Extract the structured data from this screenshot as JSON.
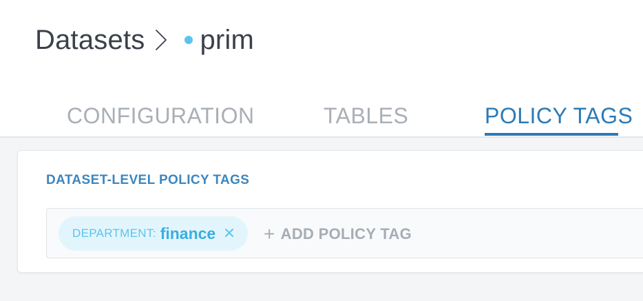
{
  "breadcrumb": {
    "parent": "Datasets",
    "separator_icon": "chevron-right-icon",
    "status_color": "#5bc4ee",
    "current": "prim"
  },
  "tabs": [
    {
      "label": "CONFIGURATION",
      "active": false
    },
    {
      "label": "TABLES",
      "active": false
    },
    {
      "label": "POLICY TAGS",
      "active": true
    }
  ],
  "policy_section": {
    "title": "DATASET-LEVEL POLICY TAGS",
    "tags": [
      {
        "key": "DEPARTMENT:",
        "value": "finance",
        "remove_icon": "close-icon"
      }
    ],
    "add_label": "ADD POLICY TAG",
    "add_icon": "plus-icon"
  },
  "colors": {
    "accent": "#2b7ab7",
    "chip_background": "#e3f5fc",
    "chip_text": "#3aaedf",
    "muted_text": "#a9afb6"
  }
}
